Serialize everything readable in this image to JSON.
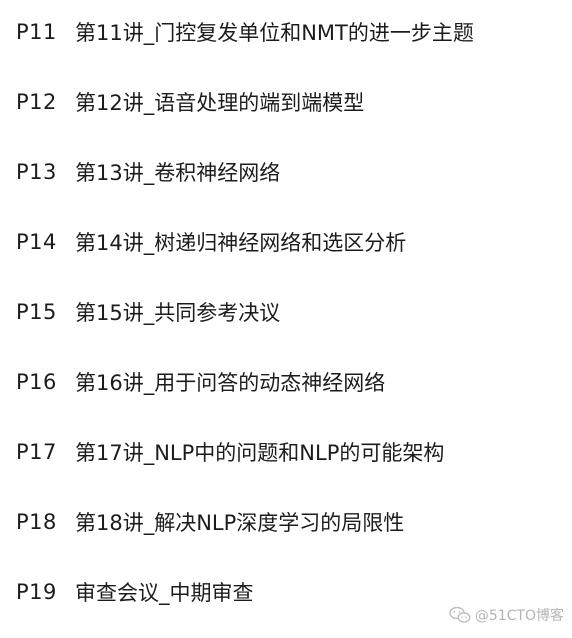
{
  "lectures": [
    {
      "code": "P11",
      "title": "第11讲_门控复发单位和NMT的进一步主题"
    },
    {
      "code": "P12",
      "title": "第12讲_语音处理的端到端模型"
    },
    {
      "code": "P13",
      "title": "第13讲_卷积神经网络"
    },
    {
      "code": "P14",
      "title": "第14讲_树递归神经网络和选区分析"
    },
    {
      "code": "P15",
      "title": "第15讲_共同参考决议"
    },
    {
      "code": "P16",
      "title": "第16讲_用于问答的动态神经网络"
    },
    {
      "code": "P17",
      "title": "第17讲_NLP中的问题和NLP的可能架构"
    },
    {
      "code": "P18",
      "title": "第18讲_解决NLP深度学习的局限性"
    },
    {
      "code": "P19",
      "title": "审查会议_中期审查"
    }
  ],
  "watermark": {
    "text": "@51CTO博客",
    "icon": "wechat-icon"
  }
}
